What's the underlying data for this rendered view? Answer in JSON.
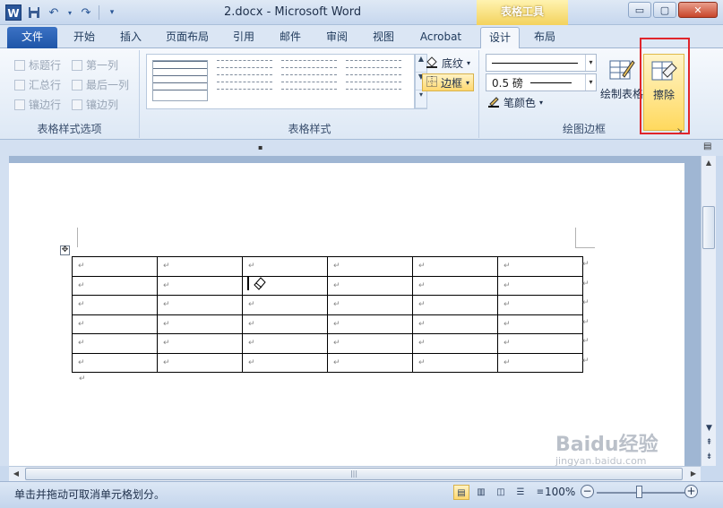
{
  "app": {
    "title": "2.docx - Microsoft Word",
    "context_tab_title": "表格工具",
    "help_icon": "?",
    "minimize_label": "▭",
    "restore_label": "▢",
    "close_label": "✕"
  },
  "tabs": [
    {
      "label": "文件"
    },
    {
      "label": "开始"
    },
    {
      "label": "插入"
    },
    {
      "label": "页面布局"
    },
    {
      "label": "引用"
    },
    {
      "label": "邮件"
    },
    {
      "label": "审阅"
    },
    {
      "label": "视图"
    },
    {
      "label": "Acrobat"
    },
    {
      "label": "设计",
      "active": true
    },
    {
      "label": "布局"
    }
  ],
  "ribbon": {
    "style_options": {
      "label": "表格样式选项",
      "checkboxes": [
        "标题行",
        "第一列",
        "汇总行",
        "最后一列",
        "镶边行",
        "镶边列"
      ]
    },
    "table_styles": {
      "label": "表格样式",
      "shading_label": "底纹",
      "border_label": "边框"
    },
    "draw_borders": {
      "label": "绘图边框",
      "line_weight": "0.5 磅",
      "pen_color_label": "笔颜色",
      "draw_table_label": "绘制表格",
      "eraser_label": "擦除"
    }
  },
  "document": {
    "table": {
      "rows": 6,
      "cols": 6,
      "cell_mark": "↵"
    },
    "paragraph_mark": "↵",
    "move_handle_icon": "✥"
  },
  "status": {
    "text": "单击并拖动可取消单元格划分。",
    "zoom": "100%"
  },
  "watermark": {
    "main": "Baidu经验",
    "sub": "jingyan.baidu.com"
  },
  "colors": {
    "accent": "#2b5797",
    "context_tab": "#f3d25c",
    "highlight_box": "#e0252b"
  }
}
